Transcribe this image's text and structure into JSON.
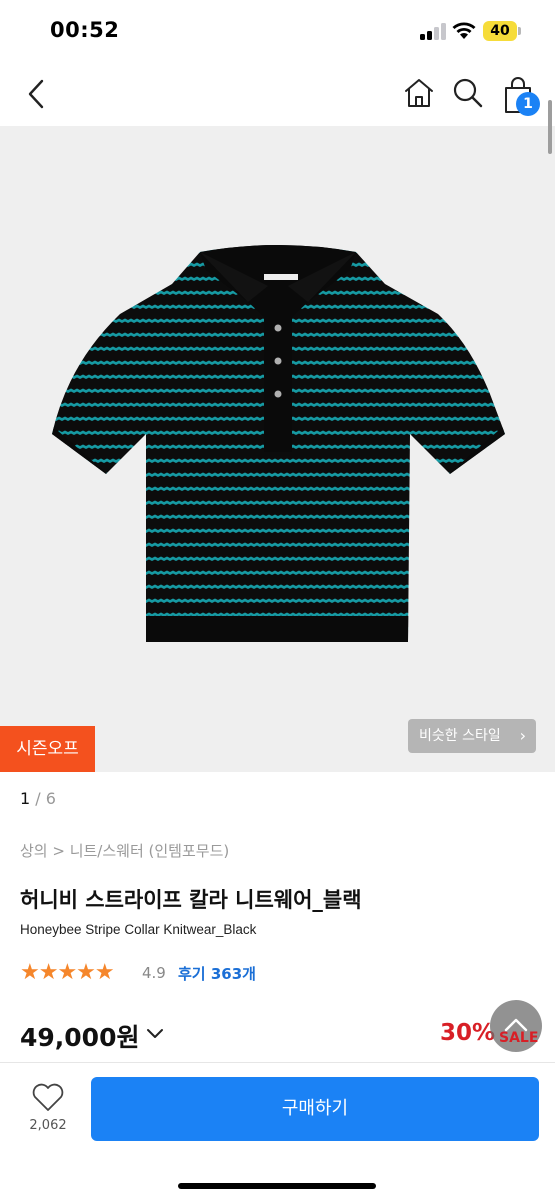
{
  "status_bar": {
    "time": "00:52",
    "battery": "40"
  },
  "nav": {
    "cart_count": "1"
  },
  "product_image": {
    "season_badge": "시즌오프",
    "similar_style": "비슷한 스타일",
    "pager": {
      "current": "1",
      "separator": "/",
      "total": "6"
    }
  },
  "product": {
    "breadcrumb": "상의 > 니트/스웨터 (인템포무드)",
    "title_ko": "허니비 스트라이프 칼라 니트웨어_블랙",
    "title_en": "Honeybee Stripe Collar Knitwear_Black",
    "rating_stars": "★★★★★",
    "rating": "4.9",
    "reviews": "후기 363개",
    "price": "49,000원",
    "discount": "30%",
    "sale_label": "SALE"
  },
  "bottom_bar": {
    "like_count": "2,062",
    "buy_label": "구매하기"
  },
  "colors": {
    "accent": "#1b82f5",
    "sale": "#d81f26",
    "badge": "#f4511e",
    "star": "#f5862b"
  }
}
